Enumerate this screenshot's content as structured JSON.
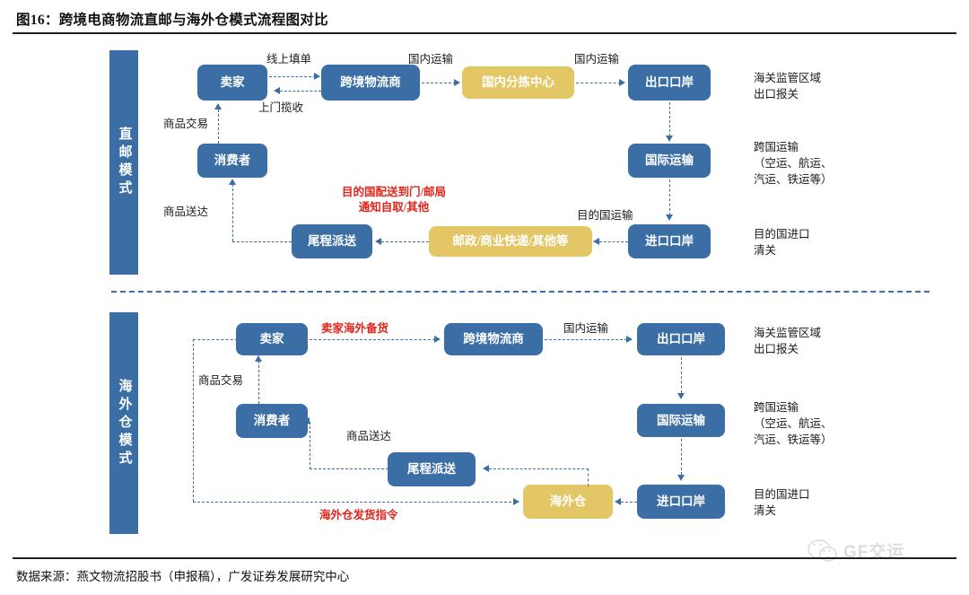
{
  "header": {
    "title": "图16：跨境电商物流直邮与海外仓模式流程图对比"
  },
  "footer": {
    "source": "数据来源：燕文物流招股书（申报稿），广发证券发展研究中心",
    "watermark": "GF交运",
    "watermark_icon": "wechat-icon"
  },
  "colors": {
    "blue": "#3a6ea5",
    "yellow": "#e3c767",
    "red": "#e1251b",
    "rule": "#1f1f1f"
  },
  "sections": [
    {
      "band_label": "直邮模式",
      "nodes": [
        {
          "key": "seller",
          "label": "卖家",
          "style": "blue"
        },
        {
          "key": "logistics",
          "label": "跨境物流商",
          "style": "blue"
        },
        {
          "key": "sorting",
          "label": "国内分拣中心",
          "style": "yellow"
        },
        {
          "key": "export_port",
          "label": "出口口岸",
          "style": "blue"
        },
        {
          "key": "intl_transport",
          "label": "国际运输",
          "style": "blue"
        },
        {
          "key": "import_port",
          "label": "进口口岸",
          "style": "blue"
        },
        {
          "key": "courier",
          "label": "邮政/商业快递/其他等",
          "style": "yellow"
        },
        {
          "key": "last_mile",
          "label": "尾程派送",
          "style": "blue"
        },
        {
          "key": "consumer",
          "label": "消费者",
          "style": "blue"
        }
      ],
      "edge_labels": [
        {
          "key": "online_form",
          "text": "线上填单"
        },
        {
          "key": "pickup",
          "text": "上门揽收"
        },
        {
          "key": "domestic_1",
          "text": "国内运输"
        },
        {
          "key": "domestic_2",
          "text": "国内运输"
        },
        {
          "key": "goods_trade",
          "text": "商品交易"
        },
        {
          "key": "goods_delivered",
          "text": "商品送达"
        },
        {
          "key": "dest_transport",
          "text": "目的国运输"
        }
      ],
      "red_notes": [
        {
          "key": "dest_delivery",
          "line1": "目的国配送到门/邮局",
          "line2": "通知自取/其他"
        }
      ],
      "side_notes": [
        {
          "key": "customs_export",
          "text": "海关监管区域\n出口报关"
        },
        {
          "key": "cross_border",
          "text": "跨国运输\n（空运、航运、\n汽运、铁运等）"
        },
        {
          "key": "dest_customs",
          "text": "目的国进口\n清关"
        }
      ]
    },
    {
      "band_label": "海外仓模式",
      "nodes": [
        {
          "key": "seller",
          "label": "卖家",
          "style": "blue"
        },
        {
          "key": "logistics",
          "label": "跨境物流商",
          "style": "blue"
        },
        {
          "key": "export_port",
          "label": "出口口岸",
          "style": "blue"
        },
        {
          "key": "intl_transport",
          "label": "国际运输",
          "style": "blue"
        },
        {
          "key": "import_port",
          "label": "进口口岸",
          "style": "blue"
        },
        {
          "key": "warehouse",
          "label": "海外仓",
          "style": "yellow"
        },
        {
          "key": "last_mile",
          "label": "尾程派送",
          "style": "blue"
        },
        {
          "key": "consumer",
          "label": "消费者",
          "style": "blue"
        }
      ],
      "edge_labels": [
        {
          "key": "goods_trade",
          "text": "商品交易"
        },
        {
          "key": "domestic_1",
          "text": "国内运输"
        },
        {
          "key": "goods_delivered",
          "text": "商品送达"
        }
      ],
      "red_notes": [
        {
          "key": "overseas_stock",
          "line1": "卖家海外备货",
          "line2": ""
        },
        {
          "key": "ship_instruction",
          "line1": "海外仓发货指令",
          "line2": ""
        }
      ],
      "side_notes": [
        {
          "key": "customs_export",
          "text": "海关监管区域\n出口报关"
        },
        {
          "key": "cross_border",
          "text": "跨国运输\n（空运、航运、\n汽运、铁运等）"
        },
        {
          "key": "dest_customs",
          "text": "目的国进口\n清关"
        }
      ]
    }
  ]
}
